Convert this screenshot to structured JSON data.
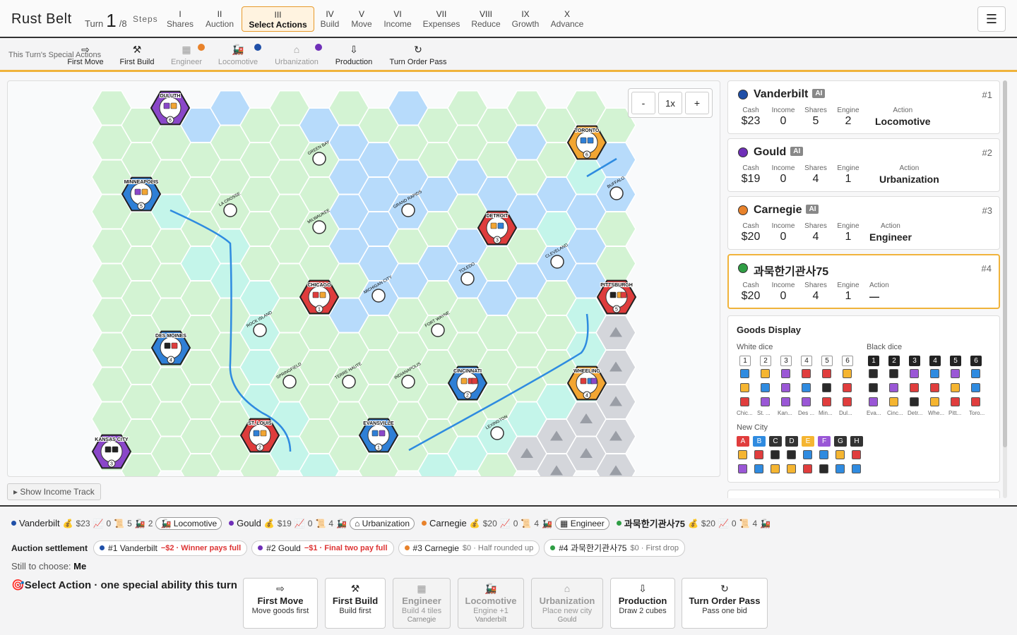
{
  "app": {
    "title": "Rust Belt"
  },
  "turn": {
    "label": "Turn",
    "current": "1",
    "total": "/8",
    "steps_label": "Steps"
  },
  "steps": [
    {
      "roman": "I",
      "label": "Shares"
    },
    {
      "roman": "II",
      "label": "Auction"
    },
    {
      "roman": "III",
      "label": "Select Actions"
    },
    {
      "roman": "IV",
      "label": "Build"
    },
    {
      "roman": "V",
      "label": "Move"
    },
    {
      "roman": "VI",
      "label": "Income"
    },
    {
      "roman": "VII",
      "label": "Expenses"
    },
    {
      "roman": "VIII",
      "label": "Reduce"
    },
    {
      "roman": "IX",
      "label": "Growth"
    },
    {
      "roman": "X",
      "label": "Advance"
    }
  ],
  "menu_icon": "☰",
  "special": {
    "label": "This Turn's Special Actions",
    "items": [
      {
        "label": "First Move",
        "icon": "⇨"
      },
      {
        "label": "First Build",
        "icon": "⚒"
      },
      {
        "label": "Engineer",
        "icon": "▦"
      },
      {
        "label": "Locomotive",
        "icon": "🚂"
      },
      {
        "label": "Urbanization",
        "icon": "⌂"
      },
      {
        "label": "Production",
        "icon": "⇩"
      },
      {
        "label": "Turn Order Pass",
        "icon": "↻"
      }
    ]
  },
  "zoom": {
    "minus": "-",
    "level": "1x",
    "plus": "+"
  },
  "map": {
    "cities": [
      {
        "name": "DULUTH",
        "num": "6"
      },
      {
        "name": "TORONTO",
        "num": "6"
      },
      {
        "name": "MINNEAPOLIS",
        "num": "5"
      },
      {
        "name": "DETROIT",
        "num": "3"
      },
      {
        "name": "CHICAGO",
        "num": "1"
      },
      {
        "name": "PITTSBURGH",
        "num": "5"
      },
      {
        "name": "DES MOINES",
        "num": "4"
      },
      {
        "name": "CINCINNATI",
        "num": "2"
      },
      {
        "name": "WHEELING",
        "num": "4"
      },
      {
        "name": "ST. LOUIS",
        "num": "2"
      },
      {
        "name": "EVANSVILLE",
        "num": "1"
      },
      {
        "name": "KANSAS CITY",
        "num": "3"
      }
    ],
    "towns": [
      "GREEN BAY",
      "BUFFALO",
      "LA CROSSE",
      "GRAND RAPIDS",
      "MILWAUKEE",
      "CLEVELAND",
      "TOLEDO",
      "MICHIGAN CITY",
      "ROCK ISLAND",
      "FORT WAYNE",
      "SPRINGFIELD",
      "TERRE HAUTE",
      "INDIANAPOLIS",
      "LEXINGTON"
    ]
  },
  "income_track": "▸ Show Income Track",
  "players": [
    {
      "name": "Vanderbilt",
      "ai": "AI",
      "rank": "#1",
      "color": "#1f4fa8",
      "cash": "$23",
      "income": "0",
      "shares": "5",
      "engine": "2",
      "action": "Locomotive"
    },
    {
      "name": "Gould",
      "ai": "AI",
      "rank": "#2",
      "color": "#6f2fb8",
      "cash": "$19",
      "income": "0",
      "shares": "4",
      "engine": "1",
      "action": "Urbanization"
    },
    {
      "name": "Carnegie",
      "ai": "AI",
      "rank": "#3",
      "color": "#e8822b",
      "cash": "$20",
      "income": "0",
      "shares": "4",
      "engine": "1",
      "action": "Engineer"
    },
    {
      "name": "과묵한기관사75",
      "ai": "",
      "rank": "#4",
      "color": "#2f9e44",
      "cash": "$20",
      "income": "0",
      "shares": "4",
      "engine": "1",
      "action": "—"
    }
  ],
  "stat_labels": {
    "cash": "Cash",
    "income": "Income",
    "shares": "Shares",
    "engine": "Engine",
    "action": "Action"
  },
  "goods": {
    "title": "Goods Display",
    "white_label": "White dice",
    "black_label": "Black dice",
    "new_city_label": "New City",
    "dice": [
      "1",
      "2",
      "3",
      "4",
      "5",
      "6"
    ],
    "white_cities": [
      "Chic...",
      "St. ...",
      "Kan...",
      "Des ...",
      "Min...",
      "Dul..."
    ],
    "black_cities": [
      "Eva...",
      "Cinc...",
      "Detr...",
      "Whe...",
      "Pitt...",
      "Toro..."
    ],
    "new_city_letters": [
      "A",
      "B",
      "C",
      "D",
      "E",
      "F",
      "G",
      "H"
    ]
  },
  "bottom": {
    "players": [
      {
        "name": "Vanderbilt",
        "cash": "$23",
        "income": "0",
        "shares": "5",
        "engine": "2",
        "action": "Locomotive"
      },
      {
        "name": "Gould",
        "cash": "$19",
        "income": "0",
        "shares": "4",
        "engine": "1",
        "action": "Urbanization"
      },
      {
        "name": "Carnegie",
        "cash": "$20",
        "income": "0",
        "shares": "4",
        "engine": "1",
        "action": "Engineer"
      },
      {
        "name": "과묵한기관사75",
        "cash": "$20",
        "income": "0",
        "shares": "4",
        "engine": "1",
        "action": ""
      }
    ],
    "settlement_label": "Auction settlement",
    "settlements": [
      {
        "pos": "#1 Vanderbilt",
        "amount": "−$2 · Winner pays full",
        "style": "red"
      },
      {
        "pos": "#2 Gould",
        "amount": "−$1 · Final two pay full",
        "style": "red"
      },
      {
        "pos": "#3 Carnegie",
        "amount": "$0 · Half rounded up",
        "style": "grey"
      },
      {
        "pos": "#4 과묵한기관사75",
        "amount": "$0 · First drop",
        "style": "grey"
      }
    ],
    "still_label": "Still to choose:",
    "still_value": "Me",
    "select_title": "Select Action · one special ability this turn",
    "actions": [
      {
        "title": "First Move",
        "sub": "Move goods first",
        "owner": "",
        "icon": "⇨"
      },
      {
        "title": "First Build",
        "sub": "Build first",
        "owner": "",
        "icon": "⚒"
      },
      {
        "title": "Engineer",
        "sub": "Build 4 tiles",
        "owner": "Carnegie",
        "icon": "▦"
      },
      {
        "title": "Locomotive",
        "sub": "Engine +1",
        "owner": "Vanderbilt",
        "icon": "🚂"
      },
      {
        "title": "Urbanization",
        "sub": "Place new city",
        "owner": "Gould",
        "icon": "⌂"
      },
      {
        "title": "Production",
        "sub": "Draw 2 cubes",
        "owner": "",
        "icon": "⇩"
      },
      {
        "title": "Turn Order Pass",
        "sub": "Pass one bid",
        "owner": "",
        "icon": "↻"
      }
    ]
  }
}
